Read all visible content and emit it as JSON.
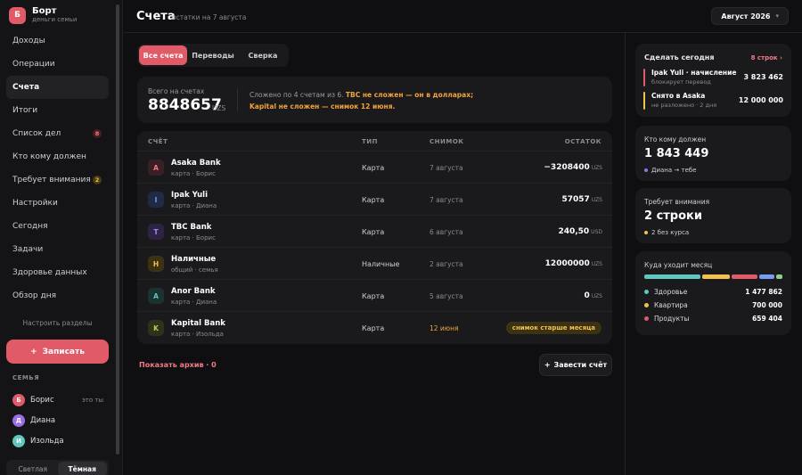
{
  "brand": {
    "logo": "Б",
    "name": "Борт",
    "subtitle": "деньги семьи"
  },
  "nav": [
    {
      "label": "Доходы"
    },
    {
      "label": "Операции"
    },
    {
      "label": "Счета",
      "active": true
    },
    {
      "label": "Итоги"
    },
    {
      "label": "Список дел",
      "badge": "8"
    },
    {
      "label": "Кто кому должен"
    },
    {
      "label": "Требует внимания",
      "badge": "2"
    },
    {
      "label": "Настройки"
    },
    {
      "label": "Сегодня"
    },
    {
      "label": "Задачи"
    },
    {
      "label": "Здоровье данных"
    },
    {
      "label": "Обзор дня"
    }
  ],
  "configure_label": "Настроить разделы",
  "record_button": {
    "icon": "+",
    "label": "Записать"
  },
  "family": {
    "title": "СЕМЬЯ",
    "members": [
      {
        "initial": "Б",
        "name": "Борис",
        "note": "это ты",
        "color": "#e05a68"
      },
      {
        "initial": "Д",
        "name": "Диана",
        "note": "",
        "color": "#9b6ee8"
      },
      {
        "initial": "И",
        "name": "Изольда",
        "note": "",
        "color": "#5fc6c0"
      }
    ]
  },
  "theme": {
    "light": "Светлая",
    "dark": "Тёмная",
    "selected": "dark"
  },
  "header": {
    "title": "Счета",
    "subtitle": "остатки на 7 августа",
    "month": "Август 2026",
    "month_icon": "chevron-down"
  },
  "tabs": [
    {
      "label": "Все счета",
      "active": true
    },
    {
      "label": "Переводы"
    },
    {
      "label": "Сверка"
    }
  ],
  "total": {
    "label": "Всего на счетах",
    "value": "8848657",
    "currency": "UZS",
    "note_prefix": "Сложено по 4 счетам из 6. ",
    "note_warn1": "TBC не сложен — он в долларах;",
    "note_warn2": "Kapital не сложен — снимок 12 июня."
  },
  "table": {
    "columns": {
      "account": "СЧЁТ",
      "type": "ТИП",
      "snapshot": "СНИМОК",
      "balance": "ОСТАТОК"
    },
    "rows": [
      {
        "initial": "A",
        "name": "Asaka Bank",
        "sub": "карта · Борис",
        "type": "Карта",
        "snapshot": "7 августа",
        "balance": "−3208400",
        "currency": "UZS",
        "icon_bg": "#3a1f25",
        "icon_fg": "#f07a86"
      },
      {
        "initial": "I",
        "name": "Ipak Yuli",
        "sub": "карта · Диана",
        "type": "Карта",
        "snapshot": "7 августа",
        "balance": "57057",
        "currency": "UZS",
        "icon_bg": "#1f2a45",
        "icon_fg": "#7a9cf0"
      },
      {
        "initial": "T",
        "name": "TBC Bank",
        "sub": "карта · Борис",
        "type": "Карта",
        "snapshot": "6 августа",
        "balance": "240,50",
        "currency": "USD",
        "icon_bg": "#2e2345",
        "icon_fg": "#a48af0"
      },
      {
        "initial": "Н",
        "name": "Наличные",
        "sub": "общий · семья",
        "type": "Наличные",
        "snapshot": "2 августа",
        "balance": "12000000",
        "currency": "UZS",
        "icon_bg": "#3d3113",
        "icon_fg": "#f2c14e"
      },
      {
        "initial": "A",
        "name": "Anor Bank",
        "sub": "карта · Диана",
        "type": "Карта",
        "snapshot": "5 августа",
        "balance": "0",
        "currency": "UZS",
        "icon_bg": "#1b3330",
        "icon_fg": "#5fc6c0"
      },
      {
        "initial": "K",
        "name": "Kapital Bank",
        "sub": "карта · Изольда",
        "type": "Карта",
        "snapshot": "12 июня",
        "balance": "",
        "currency": "",
        "badge": "снимок старше месяца",
        "icon_bg": "#2c331a",
        "icon_fg": "#b8d05a"
      }
    ]
  },
  "archive_link": "Показать архив · 0",
  "add_button": {
    "icon": "+",
    "label": "Завести счёт"
  },
  "today": {
    "title": "Сделать сегодня",
    "link": "8 строк ›",
    "items": [
      {
        "name": "Ipak Yuli · начисление",
        "sub": "блокирует перевод",
        "amount": "3 823 462",
        "color": "#e05a68"
      },
      {
        "name": "Снято в Asaka",
        "sub": "не разложено · 2 дня",
        "amount": "12 000 000",
        "color": "#f2c14e"
      }
    ]
  },
  "debts": {
    "title": "Кто кому должен",
    "value": "1 843 449",
    "note": "Диана → тебе",
    "dot_color": "#9b6ee8"
  },
  "attention": {
    "title": "Требует внимания",
    "value": "2 строки",
    "note": "2 без курса",
    "dot_color": "#f2c14e"
  },
  "spending": {
    "title": "Куда уходит месяц",
    "segments": [
      {
        "share": 0.43,
        "color": "#5fc6c0"
      },
      {
        "share": 0.21,
        "color": "#f2c14e"
      },
      {
        "share": 0.2,
        "color": "#e05a68"
      },
      {
        "share": 0.11,
        "color": "#7a9cf0"
      },
      {
        "share": 0.05,
        "color": "#8fd08f"
      }
    ],
    "items": [
      {
        "label": "Здоровье",
        "value": "1 477 862",
        "color": "#5fc6c0"
      },
      {
        "label": "Квартира",
        "value": "700 000",
        "color": "#f2c14e"
      },
      {
        "label": "Продукты",
        "value": "659 404",
        "color": "#e05a68"
      }
    ]
  }
}
